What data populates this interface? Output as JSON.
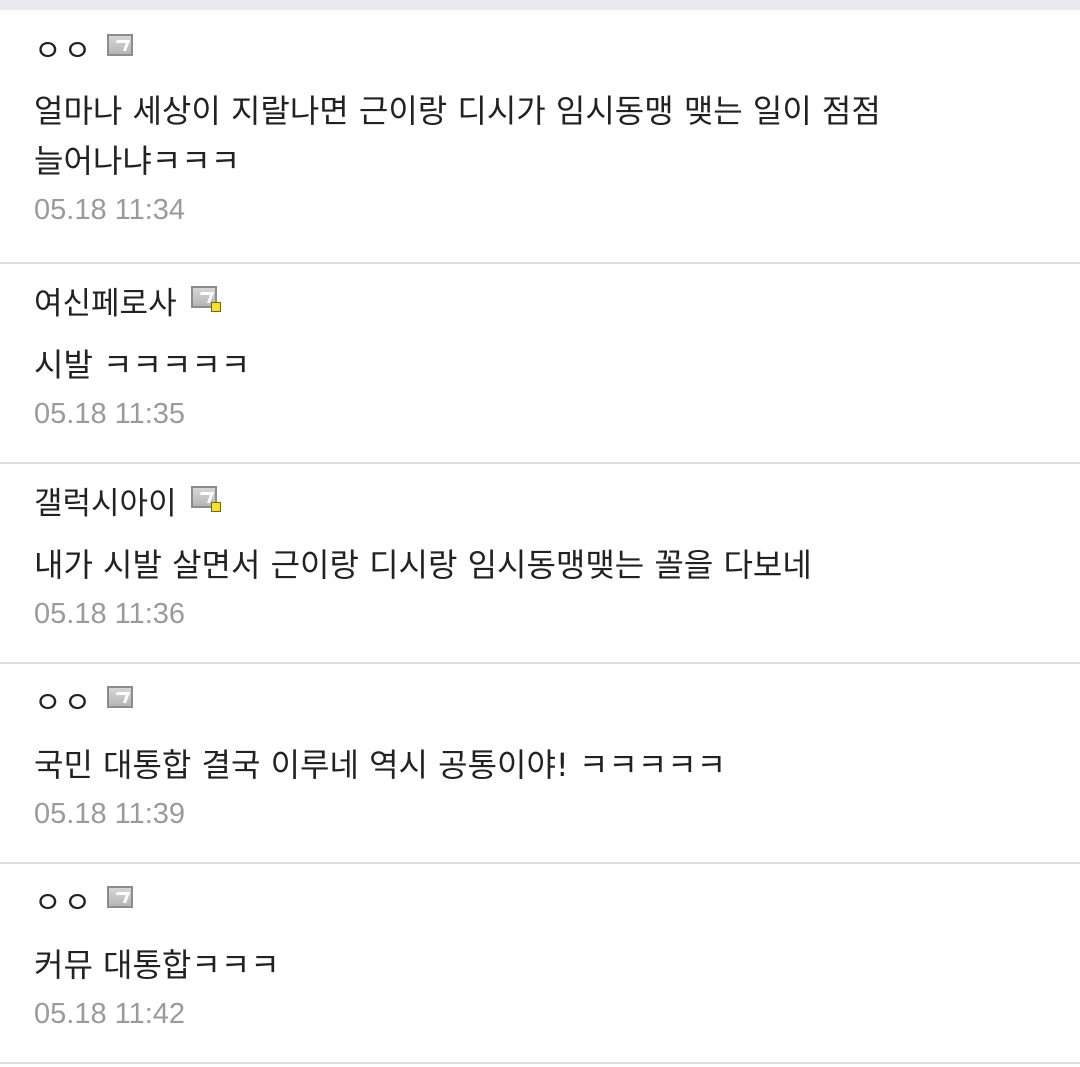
{
  "comments": [
    {
      "author": "ㅇㅇ",
      "icon": "fixed-nick-icon",
      "text": "얼마나 세상이 지랄나면 근이랑 디시가 임시동맹 맺는 일이 점점 늘어나냐ㅋㅋㅋ",
      "time": "05.18 11:34"
    },
    {
      "author": "여신페로사",
      "icon": "gallery-member-icon",
      "text": "시발 ㅋㅋㅋㅋㅋ",
      "time": "05.18 11:35"
    },
    {
      "author": "갤럭시아이",
      "icon": "gallery-member-icon",
      "text": "내가 시발 살면서 근이랑 디시랑 임시동맹맺는 꼴을 다보네",
      "time": "05.18 11:36"
    },
    {
      "author": "ㅇㅇ",
      "icon": "fixed-nick-icon",
      "text": "국민 대통합 결국 이루네 역시 공통이야! ㅋㅋㅋㅋㅋ",
      "time": "05.18 11:39"
    },
    {
      "author": "ㅇㅇ",
      "icon": "fixed-nick-icon",
      "text": "커뮤 대통합ㅋㅋㅋ",
      "time": "05.18 11:42"
    }
  ]
}
